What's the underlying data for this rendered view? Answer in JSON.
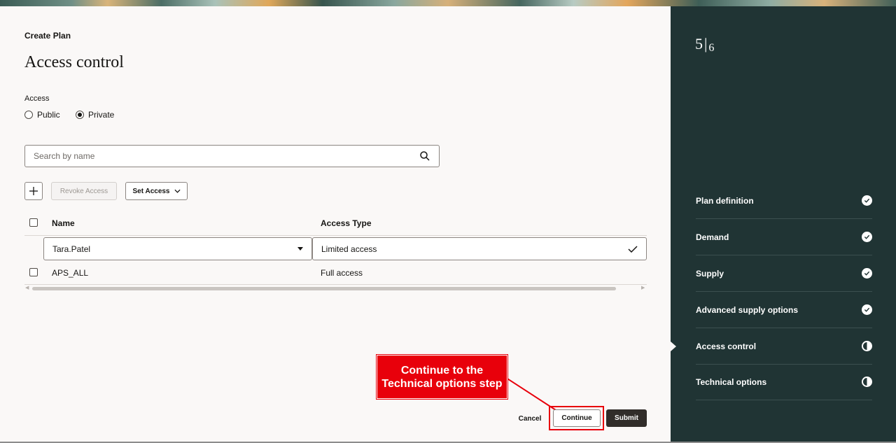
{
  "header": {
    "breadcrumb": "Create Plan",
    "title": "Access control"
  },
  "access": {
    "label": "Access",
    "options": [
      {
        "label": "Public",
        "selected": false
      },
      {
        "label": "Private",
        "selected": true
      }
    ]
  },
  "search": {
    "placeholder": "Search by name",
    "value": "",
    "icon": "search-icon"
  },
  "toolbar": {
    "add_icon": "plus-icon",
    "revoke_label": "Revoke Access",
    "set_access_label": "Set Access"
  },
  "table": {
    "columns": [
      "Name",
      "Access Type"
    ],
    "rows": [
      {
        "name": "Tara.Patel",
        "access_type": "Limited access",
        "editing": true
      },
      {
        "name": "APS_ALL",
        "access_type": "Full access",
        "editing": false
      }
    ]
  },
  "callout": {
    "text": "Continue to the Technical options step",
    "color": "#e8000b"
  },
  "footer": {
    "cancel_label": "Cancel",
    "continue_label": "Continue",
    "submit_label": "Submit"
  },
  "progress": {
    "current": "5",
    "separator": "|",
    "total": "6"
  },
  "steps": [
    {
      "label": "Plan definition",
      "status": "complete"
    },
    {
      "label": "Demand",
      "status": "complete"
    },
    {
      "label": "Supply",
      "status": "complete"
    },
    {
      "label": "Advanced supply options",
      "status": "complete"
    },
    {
      "label": "Access control",
      "status": "in-progress"
    },
    {
      "label": "Technical options",
      "status": "in-progress"
    }
  ],
  "colors": {
    "side_panel": "#203434",
    "primary_button": "#312d2a",
    "highlight": "#e8000b"
  }
}
